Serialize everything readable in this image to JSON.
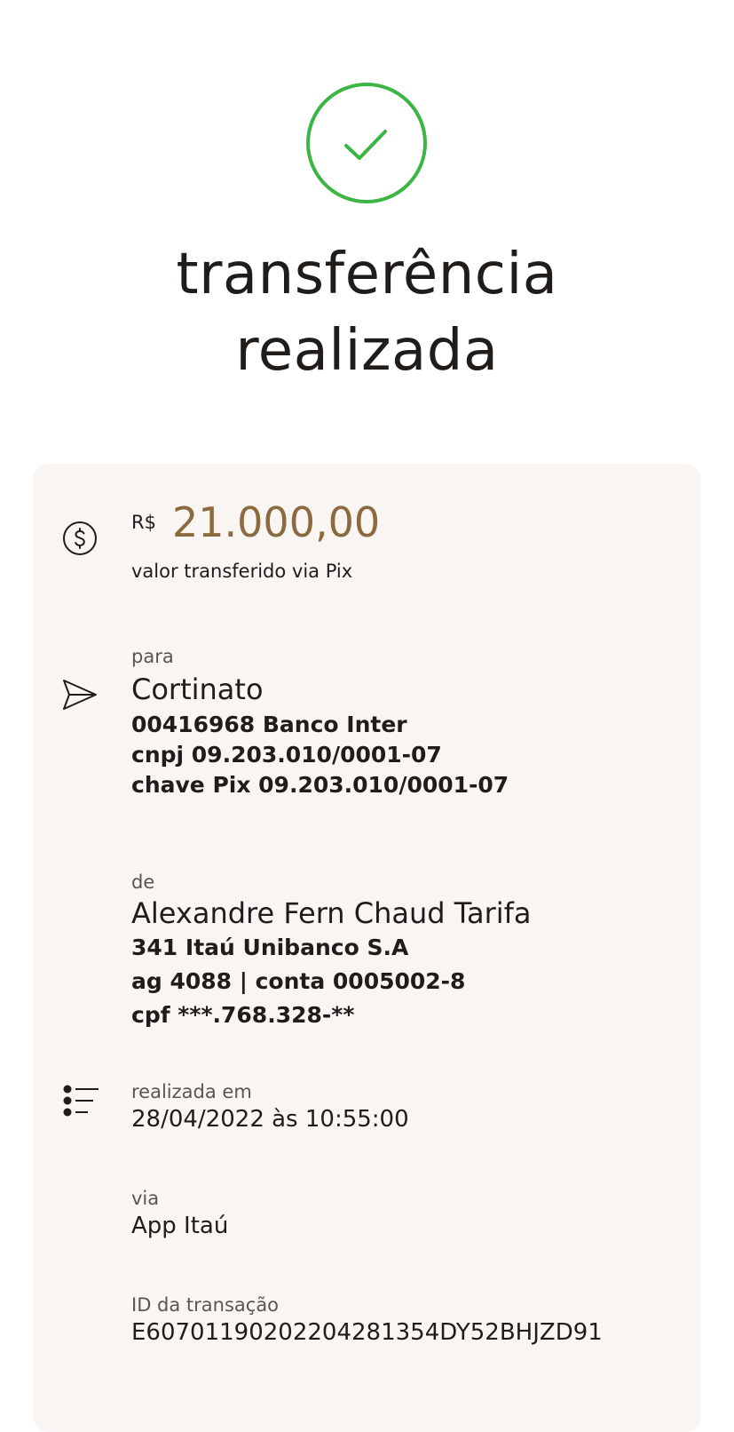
{
  "header": {
    "title_line1": "transferência",
    "title_line2": "realizada",
    "success_color": "#3cb544"
  },
  "amount": {
    "currency": "R$",
    "value": "21.000,00",
    "caption": "valor transferido via Pix",
    "color": "#8a6a3e"
  },
  "recipient": {
    "label": "para",
    "name": "Cortinato",
    "bank": "00416968 Banco Inter",
    "doc": "cnpj 09.203.010/0001-07",
    "pix_key": "chave Pix 09.203.010/0001-07"
  },
  "sender": {
    "label": "de",
    "name": "Alexandre Fern Chaud Tarifa",
    "bank": "341 Itaú Unibanco S.A",
    "account": "ag 4088 | conta 0005002-8",
    "doc": "cpf ***.768.328-**"
  },
  "details": {
    "date_label": "realizada em",
    "date_value": "28/04/2022 às 10:55:00",
    "via_label": "via",
    "via_value": "App Itaú",
    "id_label": "ID da transação",
    "id_value": "E60701190202204281354DY52BHJZD91"
  },
  "icons": {
    "success": "check-circle-icon",
    "amount": "dollar-circle-icon",
    "recipient": "send-icon",
    "details": "list-icon"
  }
}
